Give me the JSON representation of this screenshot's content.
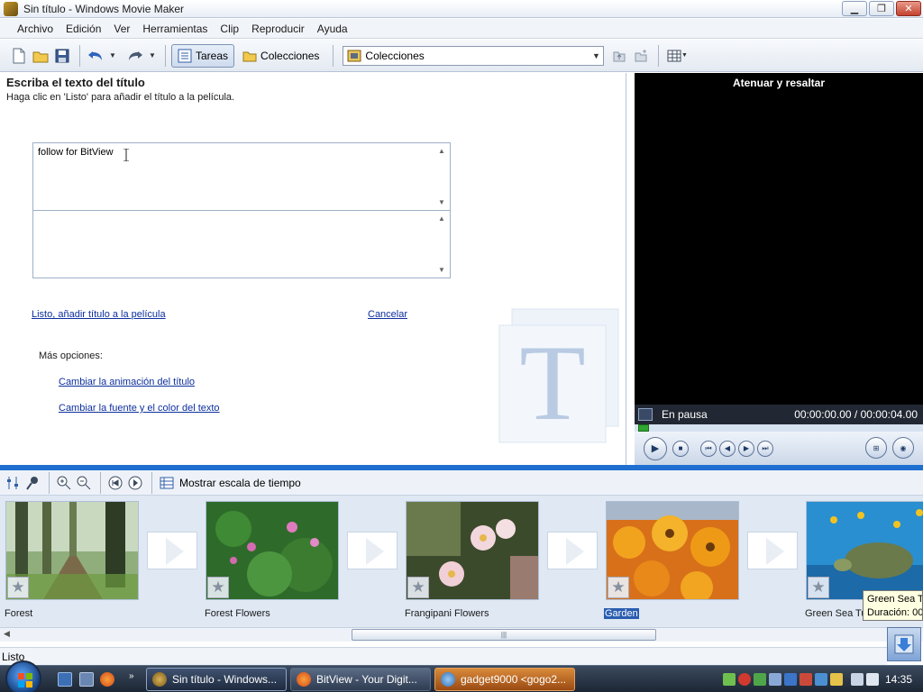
{
  "window": {
    "title": "Sin título - Windows Movie Maker"
  },
  "menu": [
    "Archivo",
    "Edición",
    "Ver",
    "Herramientas",
    "Clip",
    "Reproducir",
    "Ayuda"
  ],
  "toolbar": {
    "tasks_label": "Tareas",
    "collections_label": "Colecciones",
    "collections_combo_value": "Colecciones"
  },
  "task_pane": {
    "heading": "Escriba el texto del título",
    "instruction": "Haga clic en 'Listo' para añadir el título a la película.",
    "title_text_value": "follow for BitView",
    "subtitle_text_value": "",
    "done_link": "Listo, añadir título a la película",
    "cancel_link": "Cancelar",
    "more_options_label": "Más opciones:",
    "change_animation_link": "Cambiar la animación del título",
    "change_font_link": "Cambiar la fuente y el color del texto",
    "watermark_letter": "T"
  },
  "preview": {
    "title": "Atenuar y resaltar",
    "status": "En pausa",
    "time": "00:00:00.00 / 00:00:04.00",
    "seek_fraction": 0.0
  },
  "storyboard": {
    "show_timeline_label": "Mostrar escala de tiempo",
    "clips": [
      {
        "name": "Forest",
        "selected": false
      },
      {
        "name": "Forest Flowers",
        "selected": false
      },
      {
        "name": "Frangipani Flowers",
        "selected": false
      },
      {
        "name": "Garden",
        "selected": true
      },
      {
        "name": "Green Sea Turtle",
        "selected": false
      }
    ],
    "tooltip_line1": "Green Sea T",
    "tooltip_line2": "Duración: 00"
  },
  "statusbar": {
    "text": "Listo"
  },
  "taskbar": {
    "tasks": [
      {
        "label": "Sin título - Windows...",
        "active": true
      },
      {
        "label": "BitView - Your Digit...",
        "active": false
      },
      {
        "label": "gadget9000 <gogo2...",
        "active": false
      }
    ],
    "clock": "14:35"
  },
  "colors": {
    "accent": "#1f6fd1",
    "link": "#0c2f9e",
    "selection": "#2a5db0"
  }
}
